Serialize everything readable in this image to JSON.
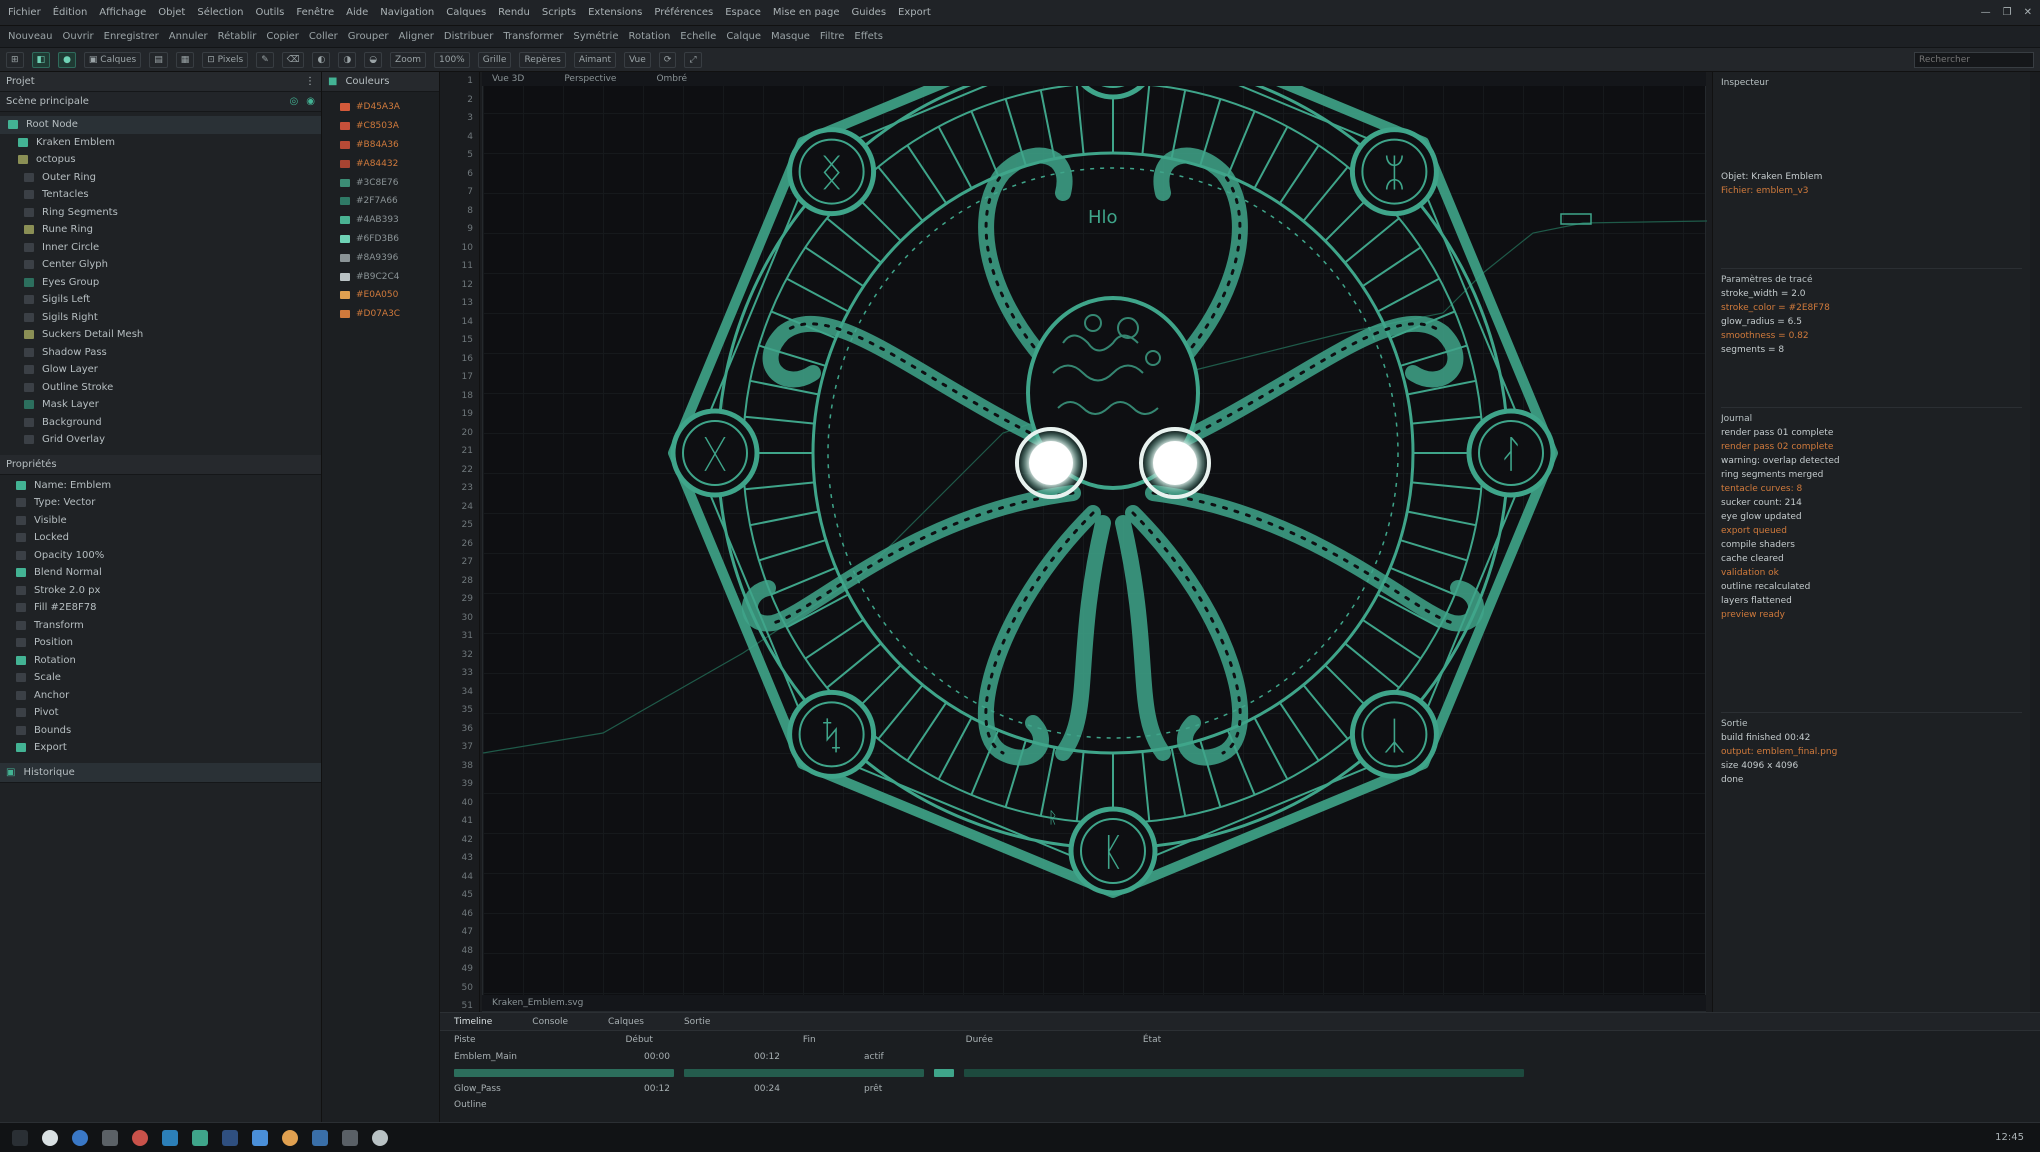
{
  "menubar": {
    "items": [
      "Fichier",
      "Édition",
      "Affichage",
      "Objet",
      "Sélection",
      "Outils",
      "Fenêtre",
      "Aide",
      "Navigation",
      "Calques",
      "Rendu",
      "Scripts",
      "Extensions",
      "Préférences",
      "Espace",
      "Mise en page",
      "Guides",
      "Export"
    ],
    "window_controls": [
      "—",
      "❐",
      "✕"
    ]
  },
  "toolbar2": {
    "items": [
      "Nouveau",
      "Ouvrir",
      "Enregistrer",
      "Annuler",
      "Rétablir",
      "Copier",
      "Coller",
      "Grouper",
      "Aligner",
      "Distribuer",
      "Transformer",
      "Symétrie",
      "Rotation",
      "Echelle",
      "Calque",
      "Masque",
      "Filtre",
      "Effets"
    ]
  },
  "toolbar3": {
    "buttons": [
      "⊞",
      "◧",
      "●",
      "▣ Calques",
      "▤",
      "▦",
      "⊡ Pixels",
      "✎",
      "⌫",
      "◐",
      "◑",
      "◒",
      "Zoom",
      "100%",
      "Grille",
      "Repères",
      "Aimant",
      "Vue",
      "⟳",
      "⤢"
    ],
    "search_placeholder": "Rechercher"
  },
  "leftpanel": {
    "header": "Projet",
    "subheader": "Scène principale",
    "items": [
      "Root Node",
      "Kraken Emblem",
      "octopus",
      "Outer Ring",
      "Tentacles",
      "Ring Segments",
      "Rune Ring",
      "Inner Circle",
      "Center Glyph",
      "Eyes Group",
      "Sigils Left",
      "Sigils Right",
      "Suckers Detail Mesh",
      "Shadow Pass",
      "Glow Layer",
      "Outline Stroke",
      "Mask Layer",
      "Background",
      "Grid Overlay"
    ],
    "section2_header": "Propriétés",
    "props": [
      "Name: Emblem",
      "Type: Vector",
      "Visible",
      "Locked",
      "Opacity 100%",
      "Blend Normal",
      "Stroke 2.0 px",
      "Fill #2E8F78",
      "Transform",
      "Position",
      "Rotation",
      "Scale",
      "Anchor",
      "Pivot",
      "Bounds",
      "Export"
    ],
    "section3_header": "Historique"
  },
  "midpanel": {
    "header": "Couleurs",
    "rows": [
      "#D45A3A",
      "#C8503A",
      "#B84A36",
      "#A84432",
      "#3C8E76",
      "#2F7A66",
      "#4AB393",
      "#6FD3B6",
      "#8A9396",
      "#B9C2C4",
      "#E0A050",
      "#D07A3C"
    ]
  },
  "gutter": {
    "lines": [
      "1",
      "2",
      "3",
      "4",
      "5",
      "6",
      "7",
      "8",
      "9",
      "10",
      "11",
      "12",
      "13",
      "14",
      "15",
      "16",
      "17",
      "18",
      "19",
      "20",
      "21",
      "22",
      "23",
      "24",
      "25",
      "26",
      "27",
      "28",
      "29",
      "30",
      "31",
      "32",
      "33",
      "34",
      "35",
      "36",
      "37",
      "38",
      "39",
      "40",
      "41",
      "42",
      "43",
      "44",
      "45",
      "46",
      "47",
      "48",
      "49",
      "50",
      "51"
    ]
  },
  "viewport": {
    "tab": "Vue 3D",
    "tab2": "Perspective",
    "tab3": "Ombré",
    "status": "Kraken_Emblem.svg"
  },
  "rightpanel": {
    "header": "Inspecteur",
    "lines1": [
      "Objet: Kraken Emblem",
      "Fichier: emblem_v3"
    ],
    "section2": "Paramètres de tracé",
    "lines2": [
      "stroke_width = 2.0",
      "stroke_color = #2E8F78",
      "glow_radius = 6.5",
      "smoothness = 0.82",
      "segments = 8"
    ],
    "section3": "Journal",
    "lines3": [
      "render pass 01 complete",
      "render pass 02 complete",
      "warning: overlap detected",
      "ring segments merged",
      "tentacle curves: 8",
      "sucker count: 214",
      "eye glow updated",
      "export queued",
      "compile shaders",
      "cache cleared",
      "validation ok",
      "outline recalculated",
      "layers flattened",
      "preview ready"
    ],
    "section4": "Sortie",
    "lines4": [
      "build finished 00:42",
      "output: emblem_final.png",
      "size 4096 x 4096",
      "done"
    ]
  },
  "bottom": {
    "tabs": [
      "Timeline",
      "Console",
      "Calques",
      "Sortie"
    ],
    "col_labels": [
      "Piste",
      "Début",
      "Fin",
      "Durée",
      "État"
    ],
    "tracks": [
      "Emblem_Main",
      "Glow_Pass",
      "Outline"
    ],
    "values": [
      "00:00",
      "00:12",
      "00:24",
      "actif",
      "prêt"
    ]
  },
  "taskbar": {
    "time": "12:45"
  },
  "colors": {
    "accent": "#3fa58a",
    "accent_bright": "#6fd3b6",
    "warn": "#d07a3c",
    "bg": "#1a1c1f",
    "viewport_bg": "#0e0f12"
  },
  "emblem": {
    "rune_glyphs": [
      "ᛟ",
      "ᛯ",
      "ᛮ",
      "ᛣ",
      "ᛕ",
      "ᛪ",
      "ᚷ",
      "ᛝ"
    ],
    "annotation_top": "Hlo",
    "annotation_bottom": "ᚱ"
  }
}
